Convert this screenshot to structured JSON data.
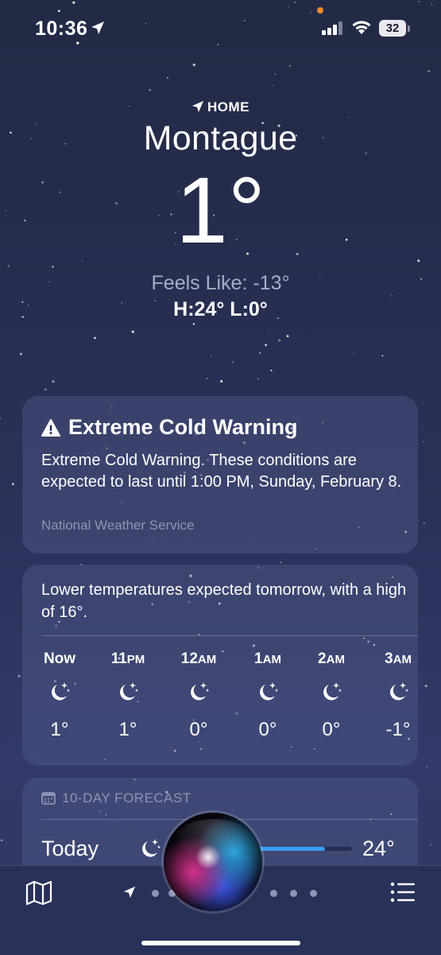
{
  "status_bar": {
    "time": "10:36",
    "battery": "32",
    "icons": [
      "location-arrow-icon",
      "signal-icon",
      "wifi-icon",
      "battery-icon"
    ]
  },
  "header": {
    "location_label": "HOME",
    "city": "Montague",
    "temperature": "1°",
    "feels_like": "Feels Like: -13°",
    "high_low": "H:24°  L:0°"
  },
  "warning": {
    "title": "Extreme Cold Warning",
    "body": "Extreme Cold Warning. These conditions are expected to last until 1:00 PM, Sunday, February 8.",
    "source": "National Weather Service"
  },
  "hourly": {
    "summary": "Lower temperatures expected tomorrow, with a high of 16°.",
    "hours": [
      {
        "label": "Now",
        "suffix": "",
        "icon": "moon-stars-icon",
        "temp": "1°"
      },
      {
        "label": "11",
        "suffix": "PM",
        "icon": "moon-stars-icon",
        "temp": "1°"
      },
      {
        "label": "12",
        "suffix": "AM",
        "icon": "moon-stars-icon",
        "temp": "0°"
      },
      {
        "label": "1",
        "suffix": "AM",
        "icon": "moon-stars-icon",
        "temp": "0°"
      },
      {
        "label": "2",
        "suffix": "AM",
        "icon": "moon-stars-icon",
        "temp": "0°"
      },
      {
        "label": "3",
        "suffix": "AM",
        "icon": "moon-stars-icon",
        "temp": "-1°"
      }
    ]
  },
  "forecast": {
    "header": "10-DAY FORECAST",
    "today": {
      "label": "Today",
      "icon": "moon-stars-icon",
      "high": "24°",
      "range_fill_fraction": 0.75
    }
  },
  "bottom_bar": {
    "left_icon": "map-icon",
    "right_icon": "list-icon",
    "page_indicator_count": 7
  },
  "colors": {
    "accent_bar": "#3b9bf2",
    "privacy_dot": "#f08a2e"
  }
}
